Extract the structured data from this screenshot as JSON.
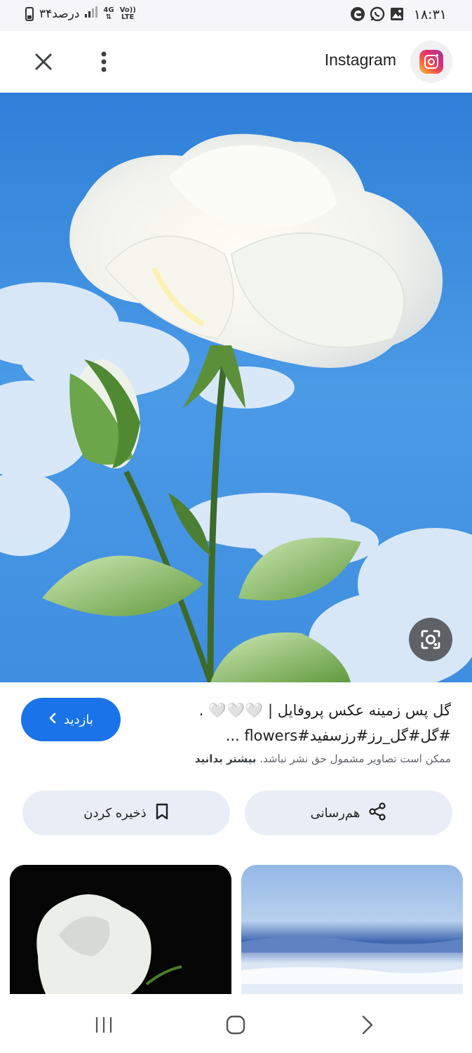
{
  "status_bar": {
    "time": "۱۸:۳۱",
    "battery_text": "۳۴درصد",
    "network_4g": "4G",
    "network_volte_top": "Vo))",
    "network_volte_bottom": "LTE",
    "icons": [
      "gallery-icon",
      "whatsapp-icon",
      "edge-icon",
      "signal-icon",
      "battery-icon"
    ]
  },
  "header": {
    "title": "Instagram",
    "close_icon": "close-icon",
    "menu_icon": "more-vert-icon",
    "logo_icon": "instagram-logo-icon"
  },
  "hero": {
    "lens_icon": "google-lens-icon"
  },
  "result": {
    "caption_line1": "گل پس زمینه عکس پروفایل | 🤍🤍🤍 .",
    "caption_line2": "#گل#گل_رز#رزسفید#flowers ...",
    "visit_label": "بازدید",
    "copyright_text": "ممکن است تصاویر مشمول حق نشر نباشد.",
    "learn_more": "بیشتر بدانید"
  },
  "actions": {
    "share_label": "هم‌رسانی",
    "save_label": "ذخیره کردن"
  },
  "navbar": {
    "recents_icon": "recents-icon",
    "home_icon": "home-icon",
    "back_icon": "back-icon"
  },
  "colors": {
    "accent": "#1a73e8",
    "chip_bg": "#e9eef6",
    "sky": "#3b8ee0"
  }
}
